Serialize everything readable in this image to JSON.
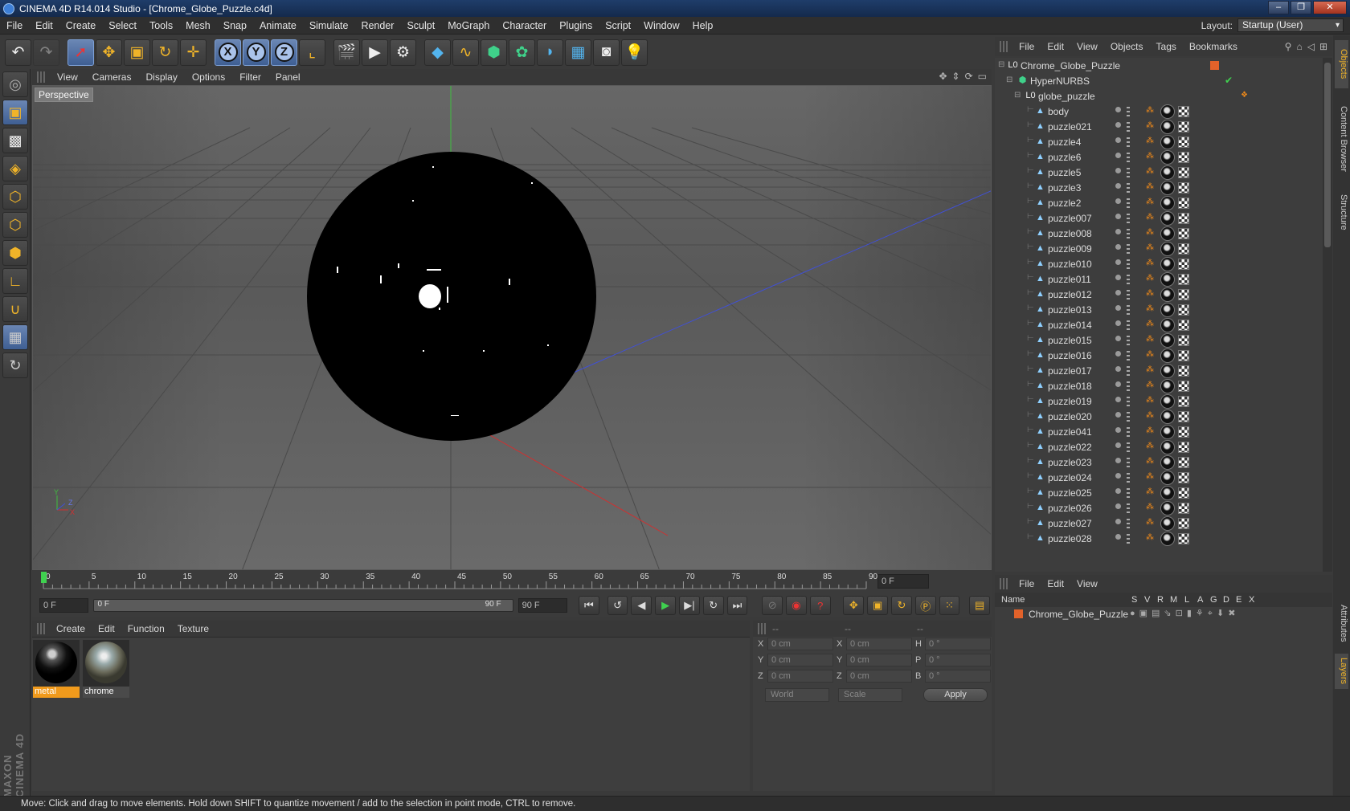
{
  "window": {
    "title": "CINEMA 4D R14.014 Studio - [Chrome_Globe_Puzzle.c4d]"
  },
  "menubar": {
    "items": [
      "File",
      "Edit",
      "Create",
      "Select",
      "Tools",
      "Mesh",
      "Snap",
      "Animate",
      "Simulate",
      "Render",
      "Sculpt",
      "MoGraph",
      "Character",
      "Plugins",
      "Script",
      "Window",
      "Help"
    ],
    "layout_label": "Layout:",
    "layout_value": "Startup (User)"
  },
  "viewport": {
    "menu": [
      "View",
      "Cameras",
      "Display",
      "Options",
      "Filter",
      "Panel"
    ],
    "label": "Perspective",
    "axis_labels": {
      "y": "Y",
      "z": "Z",
      "x": "X"
    }
  },
  "timeline": {
    "ticks": [
      "0",
      "5",
      "10",
      "15",
      "20",
      "25",
      "30",
      "35",
      "40",
      "45",
      "50",
      "55",
      "60",
      "65",
      "70",
      "75",
      "80",
      "85",
      "90"
    ],
    "current_frame": "0 F"
  },
  "transport": {
    "start": "0 F",
    "range_start": "0 F",
    "range_end": "90 F",
    "end": "90 F"
  },
  "materials": {
    "menu": [
      "Create",
      "Edit",
      "Function",
      "Texture"
    ],
    "items": [
      {
        "name": "metal",
        "selected": true
      },
      {
        "name": "chrome",
        "selected": false
      }
    ]
  },
  "coordinates": {
    "header": [
      "--",
      "--",
      "--"
    ],
    "rows": [
      {
        "a": "X",
        "av": "0 cm",
        "b": "X",
        "bv": "0 cm",
        "c": "H",
        "cv": "0 °"
      },
      {
        "a": "Y",
        "av": "0 cm",
        "b": "Y",
        "bv": "0 cm",
        "c": "P",
        "cv": "0 °"
      },
      {
        "a": "Z",
        "av": "0 cm",
        "b": "Z",
        "bv": "0 cm",
        "c": "B",
        "cv": "0 °"
      }
    ],
    "world": "World",
    "scale": "Scale",
    "apply": "Apply"
  },
  "objects": {
    "menu": [
      "File",
      "Edit",
      "View",
      "Objects",
      "Tags",
      "Bookmarks"
    ],
    "root": "Chrome_Globe_Puzzle",
    "nurbs": "HyperNURBS",
    "group": "globe_puzzle",
    "children": [
      "body",
      "puzzle021",
      "puzzle4",
      "puzzle6",
      "puzzle5",
      "puzzle3",
      "puzzle2",
      "puzzle007",
      "puzzle008",
      "puzzle009",
      "puzzle010",
      "puzzle011",
      "puzzle012",
      "puzzle013",
      "puzzle014",
      "puzzle015",
      "puzzle016",
      "puzzle017",
      "puzzle018",
      "puzzle019",
      "puzzle020",
      "puzzle041",
      "puzzle022",
      "puzzle023",
      "puzzle024",
      "puzzle025",
      "puzzle026",
      "puzzle027",
      "puzzle028"
    ]
  },
  "layers": {
    "menu": [
      "File",
      "Edit",
      "View"
    ],
    "columns": [
      "Name",
      "S",
      "V",
      "R",
      "M",
      "L",
      "A",
      "G",
      "D",
      "E",
      "X"
    ],
    "rows": [
      "Chrome_Globe_Puzzle"
    ]
  },
  "right_tabs": [
    "Objects",
    "Content Browser",
    "Structure",
    "Attributes",
    "Layers"
  ],
  "status": "Move: Click and drag to move elements. Hold down SHIFT to quantize movement / add to the selection in point mode, CTRL to remove.",
  "brand": "MAXON CINEMA 4D"
}
